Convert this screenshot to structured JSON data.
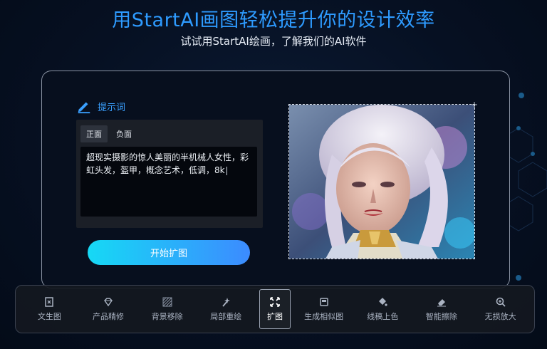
{
  "header": {
    "headline": "用StartAI画图轻松提升你的设计效率",
    "subline": "试试用StartAI绘画，了解我们的AI软件"
  },
  "prompt": {
    "title": "提示词",
    "tabs": [
      "正面",
      "负面"
    ],
    "active_tab": "正面",
    "text": "超现实摄影的惊人美丽的半机械人女性，彩虹头发，盔甲，概念艺术，低调，8k"
  },
  "start_button": {
    "label": "开始扩图"
  },
  "preview": {
    "corner_mark": "+"
  },
  "toolbar": {
    "active": "扩图",
    "tools": [
      {
        "label": "文生图",
        "icon": "text-to-image-icon"
      },
      {
        "label": "产品精修",
        "icon": "diamond-icon"
      },
      {
        "label": "背景移除",
        "icon": "background-remove-icon"
      },
      {
        "label": "局部重绘",
        "icon": "magic-wand-icon"
      },
      {
        "label": "扩图",
        "icon": "expand-icon"
      },
      {
        "label": "生成相似图",
        "icon": "similar-image-icon"
      },
      {
        "label": "线稿上色",
        "icon": "paint-bucket-icon"
      },
      {
        "label": "智能擦除",
        "icon": "eraser-icon"
      },
      {
        "label": "无损放大",
        "icon": "zoom-in-icon"
      }
    ]
  },
  "colors": {
    "accent": "#2e9bff",
    "button_start": "#16d9f5",
    "button_end": "#3c8bff"
  }
}
